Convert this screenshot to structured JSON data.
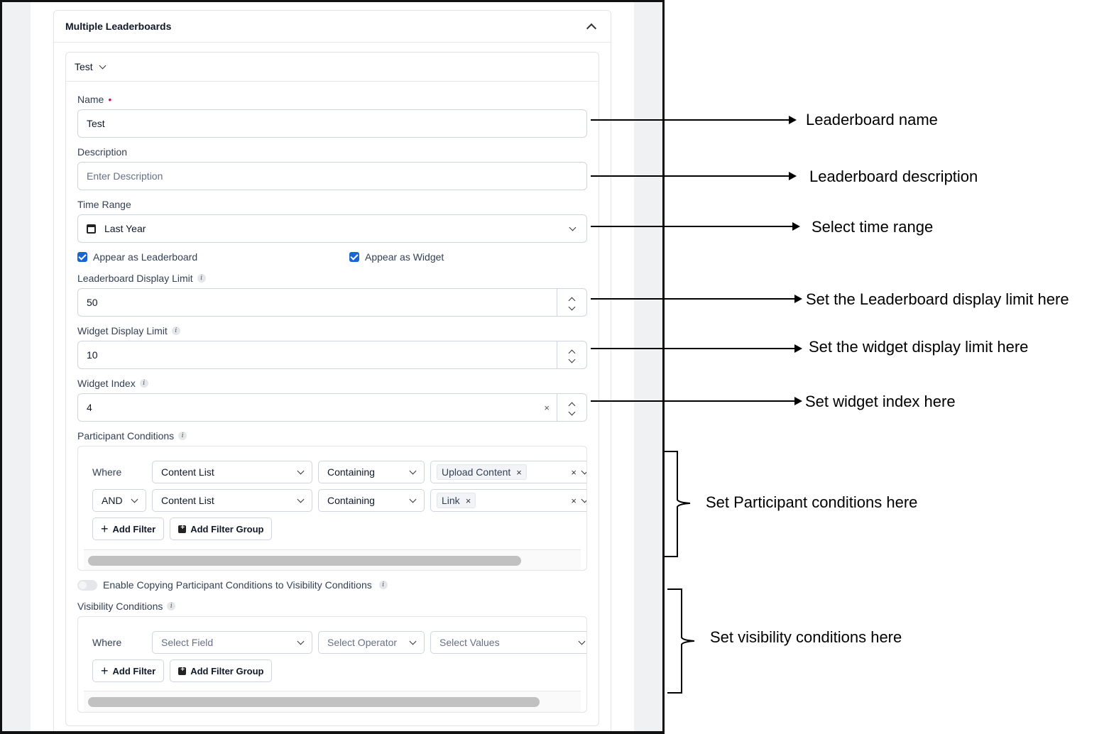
{
  "card": {
    "title": "Multiple Leaderboards"
  },
  "leaderboard": {
    "selector_label": "Test"
  },
  "name": {
    "label": "Name",
    "required_mark": "•",
    "value": "Test"
  },
  "description": {
    "label": "Description",
    "placeholder": "Enter Description"
  },
  "time_range": {
    "label": "Time Range",
    "value": "Last Year"
  },
  "checkboxes": {
    "appear_leaderboard": {
      "label": "Appear as Leaderboard",
      "checked": true
    },
    "appear_widget": {
      "label": "Appear as Widget",
      "checked": true
    }
  },
  "leaderboard_limit": {
    "label": "Leaderboard Display Limit",
    "value": "50"
  },
  "widget_limit": {
    "label": "Widget Display Limit",
    "value": "10"
  },
  "widget_index": {
    "label": "Widget Index",
    "value": "4",
    "clear": "×"
  },
  "info_glyph": "i",
  "participant": {
    "label": "Participant Conditions",
    "rows": [
      {
        "prefix": "Where",
        "field": "Content List",
        "operator": "Containing",
        "values": [
          "Upload Content"
        ]
      },
      {
        "prefix": "AND",
        "field": "Content List",
        "operator": "Containing",
        "values": [
          "Link"
        ]
      }
    ],
    "add_filter": "Add Filter",
    "add_group": "Add Filter Group"
  },
  "copy_toggle": {
    "label": "Enable Copying Participant Conditions to Visibility Conditions",
    "on": false
  },
  "visibility": {
    "label": "Visibility Conditions",
    "row": {
      "prefix": "Where",
      "field": "Select Field",
      "operator": "Select Operator",
      "values": "Select Values"
    },
    "add_filter": "Add Filter",
    "add_group": "Add Filter Group"
  },
  "glyphs": {
    "tag_remove": "×",
    "clear": "×",
    "plus": "+"
  },
  "annotations": {
    "name": "Leaderboard name",
    "description": "Leaderboard description",
    "time_range": "Select time range",
    "lb_limit": "Set the Leaderboard display limit here",
    "widget_limit": "Set the widget display limit here",
    "widget_index": "Set widget index here",
    "participant": "Set Participant conditions here",
    "visibility": "Set visibility conditions here"
  }
}
